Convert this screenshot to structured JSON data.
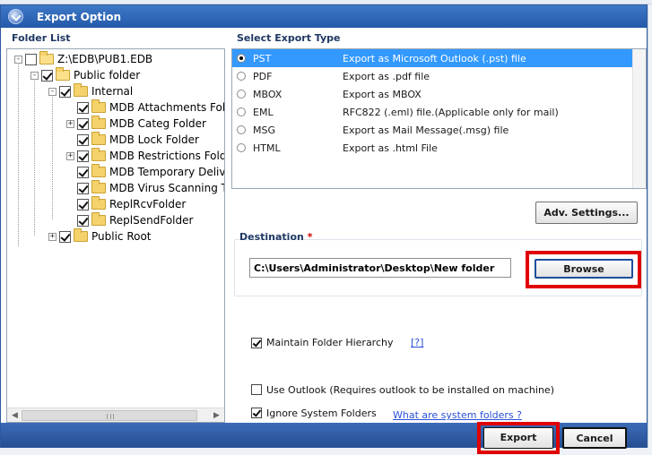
{
  "dialog": {
    "title": "Export Option"
  },
  "folder_list": {
    "label": "Folder List",
    "items": [
      {
        "label": "Z:\\EDB\\PUB1.EDB",
        "checked": false,
        "expander": "-",
        "icon": "folder-open-icon"
      },
      {
        "label": "Public folder",
        "checked": true,
        "expander": "-",
        "icon": "folder-stack-icon"
      },
      {
        "label": "Internal",
        "checked": true,
        "expander": "-",
        "icon": "folder-icon"
      },
      {
        "label": "MDB Attachments Folde",
        "checked": true,
        "expander": "",
        "icon": "folder-icon"
      },
      {
        "label": "MDB Categ Folder",
        "checked": true,
        "expander": "+",
        "icon": "folder-icon"
      },
      {
        "label": "MDB Lock Folder",
        "checked": true,
        "expander": "",
        "icon": "folder-icon"
      },
      {
        "label": "MDB Restrictions Folder",
        "checked": true,
        "expander": "+",
        "icon": "folder-icon"
      },
      {
        "label": "MDB Temporary Delivery",
        "checked": true,
        "expander": "",
        "icon": "folder-icon"
      },
      {
        "label": "MDB Virus Scanning Ter",
        "checked": true,
        "expander": "",
        "icon": "folder-icon"
      },
      {
        "label": "ReplRcvFolder",
        "checked": true,
        "expander": "",
        "icon": "folder-icon"
      },
      {
        "label": "ReplSendFolder",
        "checked": true,
        "expander": "",
        "icon": "folder-icon"
      },
      {
        "label": "Public Root",
        "checked": true,
        "expander": "+",
        "icon": "folder-icon"
      }
    ]
  },
  "export_type": {
    "label": "Select Export Type",
    "options": [
      {
        "code": "PST",
        "desc": "Export as Microsoft Outlook (.pst) file",
        "selected": true
      },
      {
        "code": "PDF",
        "desc": "Export as .pdf file",
        "selected": false
      },
      {
        "code": "MBOX",
        "desc": "Export as MBOX",
        "selected": false
      },
      {
        "code": "EML",
        "desc": "RFC822 (.eml) file.(Applicable only for mail)",
        "selected": false
      },
      {
        "code": "MSG",
        "desc": "Export as Mail Message(.msg) file",
        "selected": false
      },
      {
        "code": "HTML",
        "desc": "Export as .html File",
        "selected": false
      }
    ],
    "adv_settings_label": "Adv. Settings..."
  },
  "destination": {
    "label": "Destination",
    "required_mark": "*",
    "path": "C:\\Users\\Administrator\\Desktop\\New folder",
    "browse_label": "Browse"
  },
  "options": {
    "maintain_hierarchy": {
      "label": "Maintain Folder Hierarchy",
      "checked": true,
      "help": "[?]"
    },
    "use_outlook": {
      "label": "Use Outlook (Requires outlook to be installed on machine)",
      "checked": false
    },
    "ignore_system": {
      "label": "Ignore System Folders",
      "checked": true,
      "link": "What are system folders ?"
    }
  },
  "footer": {
    "export_label": "Export",
    "cancel_label": "Cancel"
  },
  "colors": {
    "title_bar": "#2d62b0",
    "selection": "#3399ff",
    "highlight": "#e00000",
    "link": "#2a4fd8"
  }
}
